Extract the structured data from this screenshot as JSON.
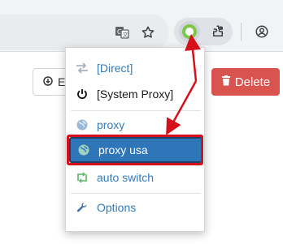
{
  "toolbar": {
    "translate_icon": "translate-icon",
    "bookmark_icon": "star-icon",
    "extension_icon": "switchyomega-icon",
    "puzzle_icon": "extensions-puzzle-icon",
    "profile_icon": "profile-icon"
  },
  "page": {
    "left_button_label": "E",
    "delete_button_label": "Delete"
  },
  "menu": {
    "items": [
      {
        "label": "[Direct]",
        "icon": "direct-exchange-icon"
      },
      {
        "label": "[System Proxy]",
        "icon": "power-icon"
      },
      {
        "label": "proxy",
        "icon": "globe-icon"
      },
      {
        "label": "proxy usa",
        "icon": "globe-icon",
        "selected": true
      },
      {
        "label": "auto switch",
        "icon": "retweet-icon"
      },
      {
        "label": "Options",
        "icon": "wrench-icon"
      }
    ]
  },
  "colors": {
    "accent": "#337ab7",
    "selected_bg": "#2f76b9",
    "annotation_red": "#d5101a",
    "delete_red": "#d9534f",
    "extension_green": "#7fc64a"
  }
}
